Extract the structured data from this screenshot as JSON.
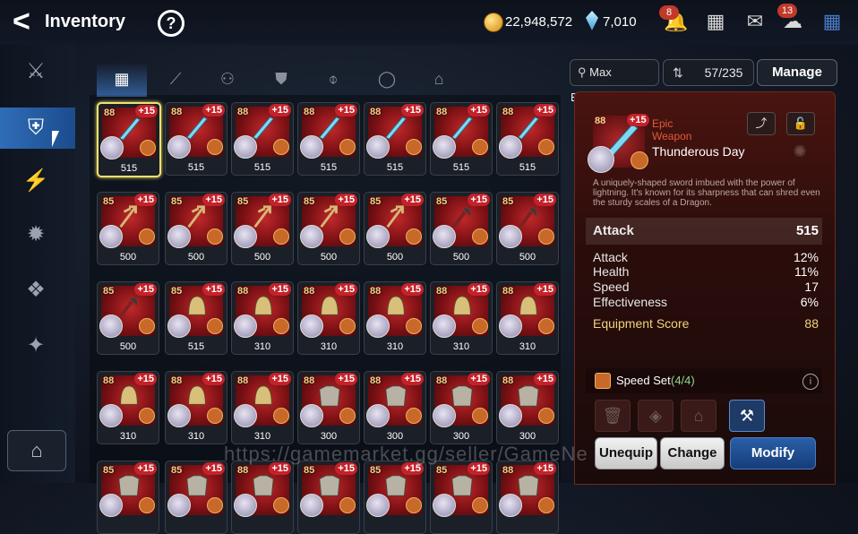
{
  "header": {
    "back_glyph": "<",
    "title": "Inventory",
    "help_glyph": "?",
    "gold": "22,948,572",
    "crystals": "7,010",
    "notification_badge": "8",
    "chat_badge": "13",
    "icons": [
      "gold-coin-icon",
      "crystal-icon",
      "bell-icon",
      "gift-shop-icon",
      "mail-icon",
      "chat-icon",
      "menu-grid-icon"
    ]
  },
  "sidebar": {
    "items": [
      {
        "name": "equipment-tab",
        "glyph": "⚔"
      },
      {
        "name": "weapon-tab-active",
        "glyph": "⛨"
      },
      {
        "name": "artifact-tab",
        "glyph": "⚡"
      },
      {
        "name": "material-tab",
        "glyph": "✹"
      },
      {
        "name": "consumable-tab",
        "glyph": "❖"
      },
      {
        "name": "chest-tab",
        "glyph": "✦"
      }
    ],
    "storage_glyph": "⌂"
  },
  "filter_tabs": [
    "▦",
    "⟋",
    "⚇",
    "⛊",
    "⌽",
    "◯",
    "⌂"
  ],
  "grid": [
    [
      {
        "lvl": "88",
        "enh": "+15",
        "stat": "515",
        "kind": "sword"
      },
      {
        "lvl": "88",
        "enh": "+15",
        "stat": "515",
        "kind": "sword"
      },
      {
        "lvl": "88",
        "enh": "+15",
        "stat": "515",
        "kind": "sword"
      },
      {
        "lvl": "88",
        "enh": "+15",
        "stat": "515",
        "kind": "sword"
      },
      {
        "lvl": "88",
        "enh": "+15",
        "stat": "515",
        "kind": "sword"
      },
      {
        "lvl": "88",
        "enh": "+15",
        "stat": "515",
        "kind": "sword"
      },
      {
        "lvl": "88",
        "enh": "+15",
        "stat": "515",
        "kind": "sword"
      }
    ],
    [
      {
        "lvl": "85",
        "enh": "+15",
        "stat": "500",
        "kind": "trident"
      },
      {
        "lvl": "85",
        "enh": "+15",
        "stat": "500",
        "kind": "trident"
      },
      {
        "lvl": "85",
        "enh": "+15",
        "stat": "500",
        "kind": "trident"
      },
      {
        "lvl": "85",
        "enh": "+15",
        "stat": "500",
        "kind": "trident"
      },
      {
        "lvl": "85",
        "enh": "+15",
        "stat": "500",
        "kind": "trident"
      },
      {
        "lvl": "85",
        "enh": "+15",
        "stat": "500",
        "kind": "axe"
      },
      {
        "lvl": "85",
        "enh": "+15",
        "stat": "500",
        "kind": "axe"
      }
    ],
    [
      {
        "lvl": "85",
        "enh": "+15",
        "stat": "500",
        "kind": "axe"
      },
      {
        "lvl": "85",
        "enh": "+15",
        "stat": "515",
        "kind": "helm"
      },
      {
        "lvl": "88",
        "enh": "+15",
        "stat": "310",
        "kind": "helm"
      },
      {
        "lvl": "88",
        "enh": "+15",
        "stat": "310",
        "kind": "helm"
      },
      {
        "lvl": "88",
        "enh": "+15",
        "stat": "310",
        "kind": "helm"
      },
      {
        "lvl": "88",
        "enh": "+15",
        "stat": "310",
        "kind": "helm"
      },
      {
        "lvl": "88",
        "enh": "+15",
        "stat": "310",
        "kind": "helm"
      }
    ],
    [
      {
        "lvl": "88",
        "enh": "+15",
        "stat": "310",
        "kind": "helm"
      },
      {
        "lvl": "88",
        "enh": "+15",
        "stat": "310",
        "kind": "helm"
      },
      {
        "lvl": "88",
        "enh": "+15",
        "stat": "310",
        "kind": "helm"
      },
      {
        "lvl": "88",
        "enh": "+15",
        "stat": "300",
        "kind": "armor"
      },
      {
        "lvl": "88",
        "enh": "+15",
        "stat": "300",
        "kind": "armor"
      },
      {
        "lvl": "88",
        "enh": "+15",
        "stat": "300",
        "kind": "armor"
      },
      {
        "lvl": "88",
        "enh": "+15",
        "stat": "300",
        "kind": "armor"
      }
    ],
    [
      {
        "lvl": "85",
        "enh": "+15",
        "stat": "",
        "kind": "armor"
      },
      {
        "lvl": "85",
        "enh": "+15",
        "stat": "",
        "kind": "armor"
      },
      {
        "lvl": "88",
        "enh": "+15",
        "stat": "",
        "kind": "armor"
      },
      {
        "lvl": "85",
        "enh": "+15",
        "stat": "",
        "kind": "armor"
      },
      {
        "lvl": "85",
        "enh": "+15",
        "stat": "",
        "kind": "armor"
      },
      {
        "lvl": "85",
        "enh": "+15",
        "stat": "",
        "kind": "armor"
      },
      {
        "lvl": "88",
        "enh": "+15",
        "stat": "",
        "kind": "armor"
      }
    ]
  ],
  "toolbar": {
    "max_enhance": "Max Enhance",
    "capacity": "57/235",
    "manage": "Manage"
  },
  "detail": {
    "level": "88",
    "enhance": "+15",
    "grade": "Epic",
    "type": "Weapon",
    "name": "Thunderous Day",
    "description": "A uniquely-shaped sword imbued with the power of lightning. It's known for its sharpness that can shred even the sturdy scales of a Dragon.",
    "main_stat_label": "Attack",
    "main_stat_value": "515",
    "substats": [
      {
        "label": "Attack",
        "value": "12%"
      },
      {
        "label": "Health",
        "value": "11%"
      },
      {
        "label": "Speed",
        "value": "17"
      },
      {
        "label": "Effectiveness",
        "value": "6%"
      }
    ],
    "score_label": "Equipment Score",
    "score_value": "88",
    "set_name": "Speed Set",
    "set_count": "(4/4)",
    "buttons": {
      "unequip": "Unequip",
      "change": "Change",
      "modify": "Modify"
    },
    "colors": {
      "grade": "#e05a3a",
      "score": "#f2d27a"
    }
  },
  "watermark": "https://gamemarket.gg/seller/GameNe"
}
